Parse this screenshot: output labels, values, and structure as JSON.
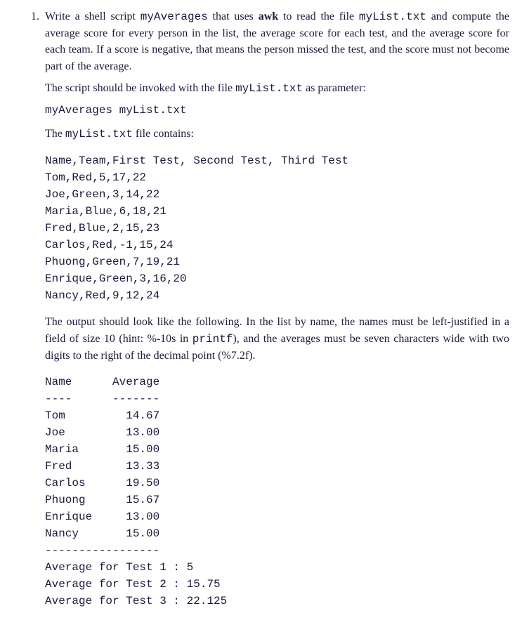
{
  "number": "1.",
  "p1_a": "Write a shell script ",
  "p1_b": "myAverages",
  "p1_c": " that uses ",
  "p1_d": "awk",
  "p1_e": " to read the file ",
  "p1_f": "myList.txt",
  "p1_g": " and compute the average score for every person in the list, the average score for each test, and the average score for each team. If a score is negative, that means the person missed the test, and the score must not become part of the average.",
  "p2_a": "The script should be invoked with the file ",
  "p2_b": "myList.txt",
  "p2_c": " as parameter:",
  "p2_cmd": "myAverages myList.txt",
  "p3_a": "The ",
  "p3_b": "myList.txt",
  "p3_c": " file contains:",
  "filecontents": "Name,Team,First Test, Second Test, Third Test\nTom,Red,5,17,22\nJoe,Green,3,14,22\nMaria,Blue,6,18,21\nFred,Blue,2,15,23\nCarlos,Red,-1,15,24\nPhuong,Green,7,19,21\nEnrique,Green,3,16,20\nNancy,Red,9,12,24",
  "p4_a": "The output should look like the following. In the list by name, the names must be left-justified in a field of size 10 (hint: %-10s in ",
  "p4_b": "printf",
  "p4_c": "), and the averages must be seven characters wide with two digits to the right of the decimal point (%7.2f).",
  "output": "Name      Average\n----      -------\nTom         14.67\nJoe         13.00\nMaria       15.00\nFred        13.33\nCarlos      19.50\nPhuong      15.67\nEnrique     13.00\nNancy       15.00\n-----------------\nAverage for Test 1 : 5\nAverage for Test 2 : 15.75\nAverage for Test 3 : 22.125"
}
